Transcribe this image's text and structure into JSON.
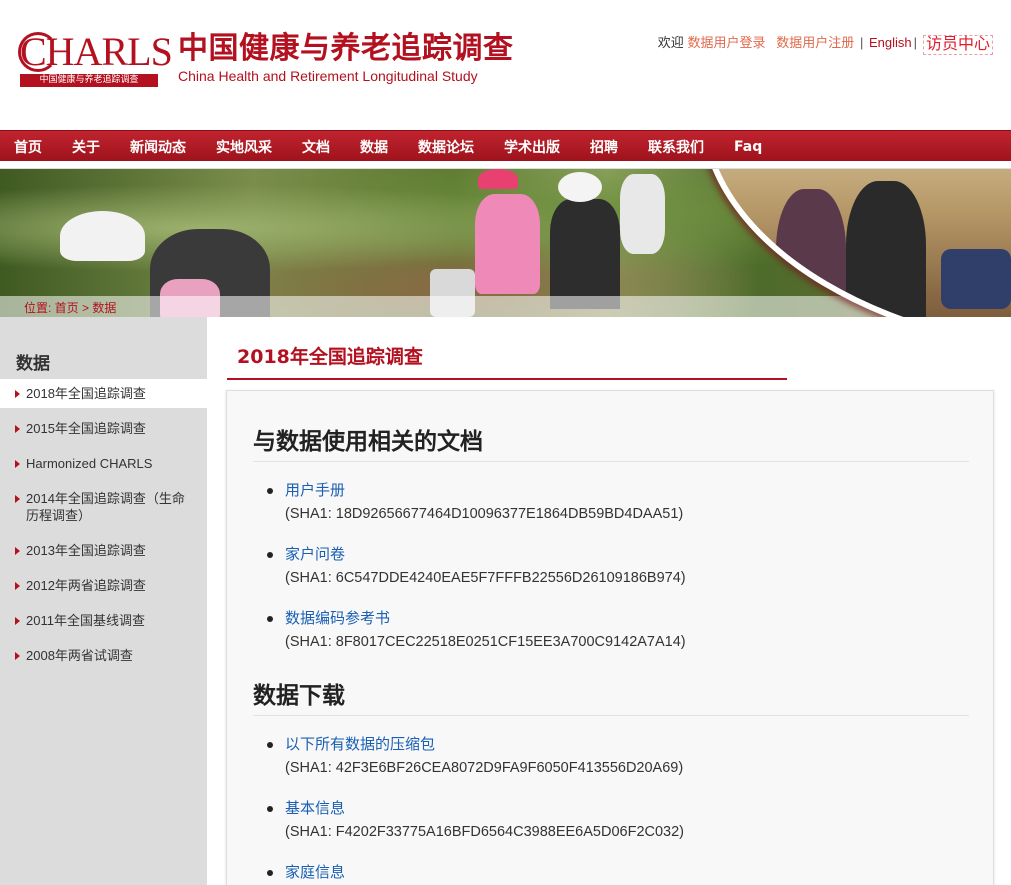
{
  "header": {
    "logo_text": "CHARLS",
    "logo_subtext": "中国健康与养老追踪调查",
    "title": "中国健康与养老追踪调查",
    "subtitle": "China Health and Retirement Longitudinal Study",
    "top_links": {
      "welcome": "欢迎",
      "login": "数据用户登录",
      "register": "数据用户注册",
      "sep1": "|",
      "english": "English",
      "sep2": "|",
      "visitor_center": "访员中心"
    }
  },
  "nav": {
    "items": [
      "首页",
      "关于",
      "新闻动态",
      "实地风采",
      "文档",
      "数据",
      "数据论坛",
      "学术出版",
      "招聘",
      "联系我们",
      "Faq"
    ]
  },
  "breadcrumb": {
    "prefix": "位置: ",
    "home": "首页",
    "separator": " > ",
    "current": "数据"
  },
  "sidebar": {
    "title": "数据",
    "items": [
      {
        "label": "2018年全国追踪调查",
        "active": true
      },
      {
        "label": "2015年全国追踪调查"
      },
      {
        "label": "Harmonized CHARLS"
      },
      {
        "label": "2014年全国追踪调查（生命历程调查）"
      },
      {
        "label": "2013年全国追踪调查"
      },
      {
        "label": "2012年两省追踪调查"
      },
      {
        "label": "2011年全国基线调查"
      },
      {
        "label": "2008年两省试调查"
      }
    ]
  },
  "main": {
    "page_title": "2018年全国追踪调查",
    "sections": [
      {
        "heading": "与数据使用相关的文档",
        "items": [
          {
            "link": "用户手册",
            "hash": "(SHA1: 18D92656677464D10096377E1864DB59BD4DAA51)"
          },
          {
            "link": "家户问卷",
            "hash": "(SHA1: 6C547DDE4240EAE5F7FFFB22556D26109186B974)"
          },
          {
            "link": "数据编码参考书",
            "hash": "(SHA1: 8F8017CEC22518E0251CF15EE3A700C9142A7A14)"
          }
        ]
      },
      {
        "heading": "数据下载",
        "items": [
          {
            "link": "以下所有数据的压缩包",
            "hash": "(SHA1: 42F3E6BF26CEA8072D9FA9F6050F413556D20A69)"
          },
          {
            "link": "基本信息",
            "hash": "(SHA1: F4202F33775A16BFD6564C3988EE6A5D06F2C032)"
          },
          {
            "link": "家庭信息",
            "hash": ""
          }
        ]
      }
    ]
  },
  "colors": {
    "brand_red": "#b3111f",
    "link_blue": "#1a5fb4",
    "top_link_orange": "#e06a4b",
    "sidebar_bg": "#dcdcdc"
  }
}
